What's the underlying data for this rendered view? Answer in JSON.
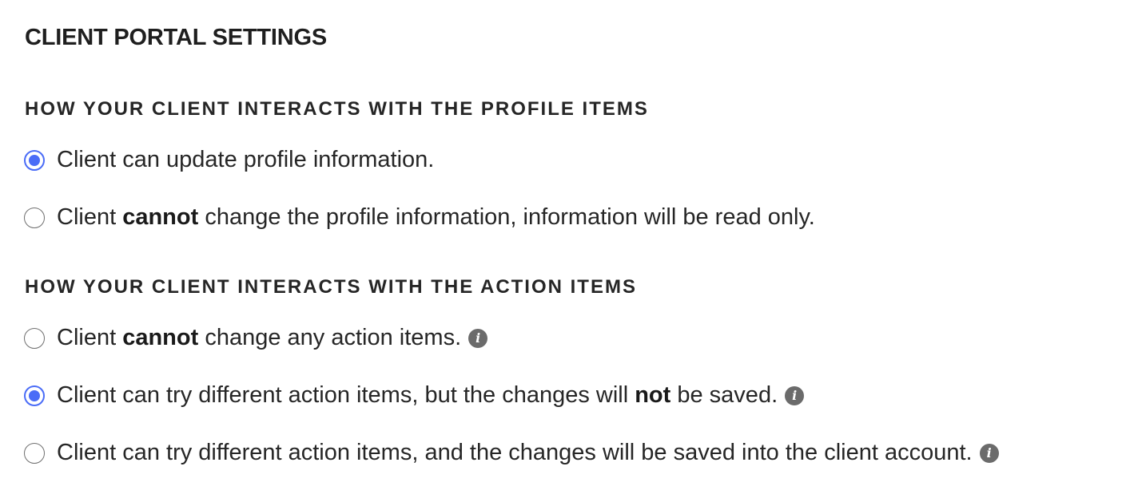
{
  "page": {
    "title": "CLIENT PORTAL SETTINGS"
  },
  "profile_section": {
    "heading": "HOW YOUR CLIENT INTERACTS WITH THE PROFILE ITEMS",
    "options": [
      {
        "checked": true,
        "text": "Client can update profile information."
      },
      {
        "checked": false,
        "prefix": "Client ",
        "bold": "cannot",
        "suffix": " change the profile information, information will be read only."
      }
    ]
  },
  "action_section": {
    "heading": "HOW YOUR CLIENT INTERACTS WITH THE ACTION ITEMS",
    "options": [
      {
        "checked": false,
        "prefix": "Client ",
        "bold": "cannot",
        "suffix": " change any action items.",
        "info_icon": "info-icon"
      },
      {
        "checked": true,
        "prefix": "Client can try different action items, but the changes will ",
        "bold": "not",
        "suffix": " be saved.",
        "info_icon": "info-icon"
      },
      {
        "checked": false,
        "text": "Client can try different action items, and the changes will be saved into the client account.",
        "info_icon": "info-icon"
      }
    ]
  },
  "icons": {
    "info_glyph": "i"
  },
  "colors": {
    "radio_checked": "#4a6cf7",
    "info_icon_bg": "#6b6b6b",
    "text": "#262626"
  }
}
